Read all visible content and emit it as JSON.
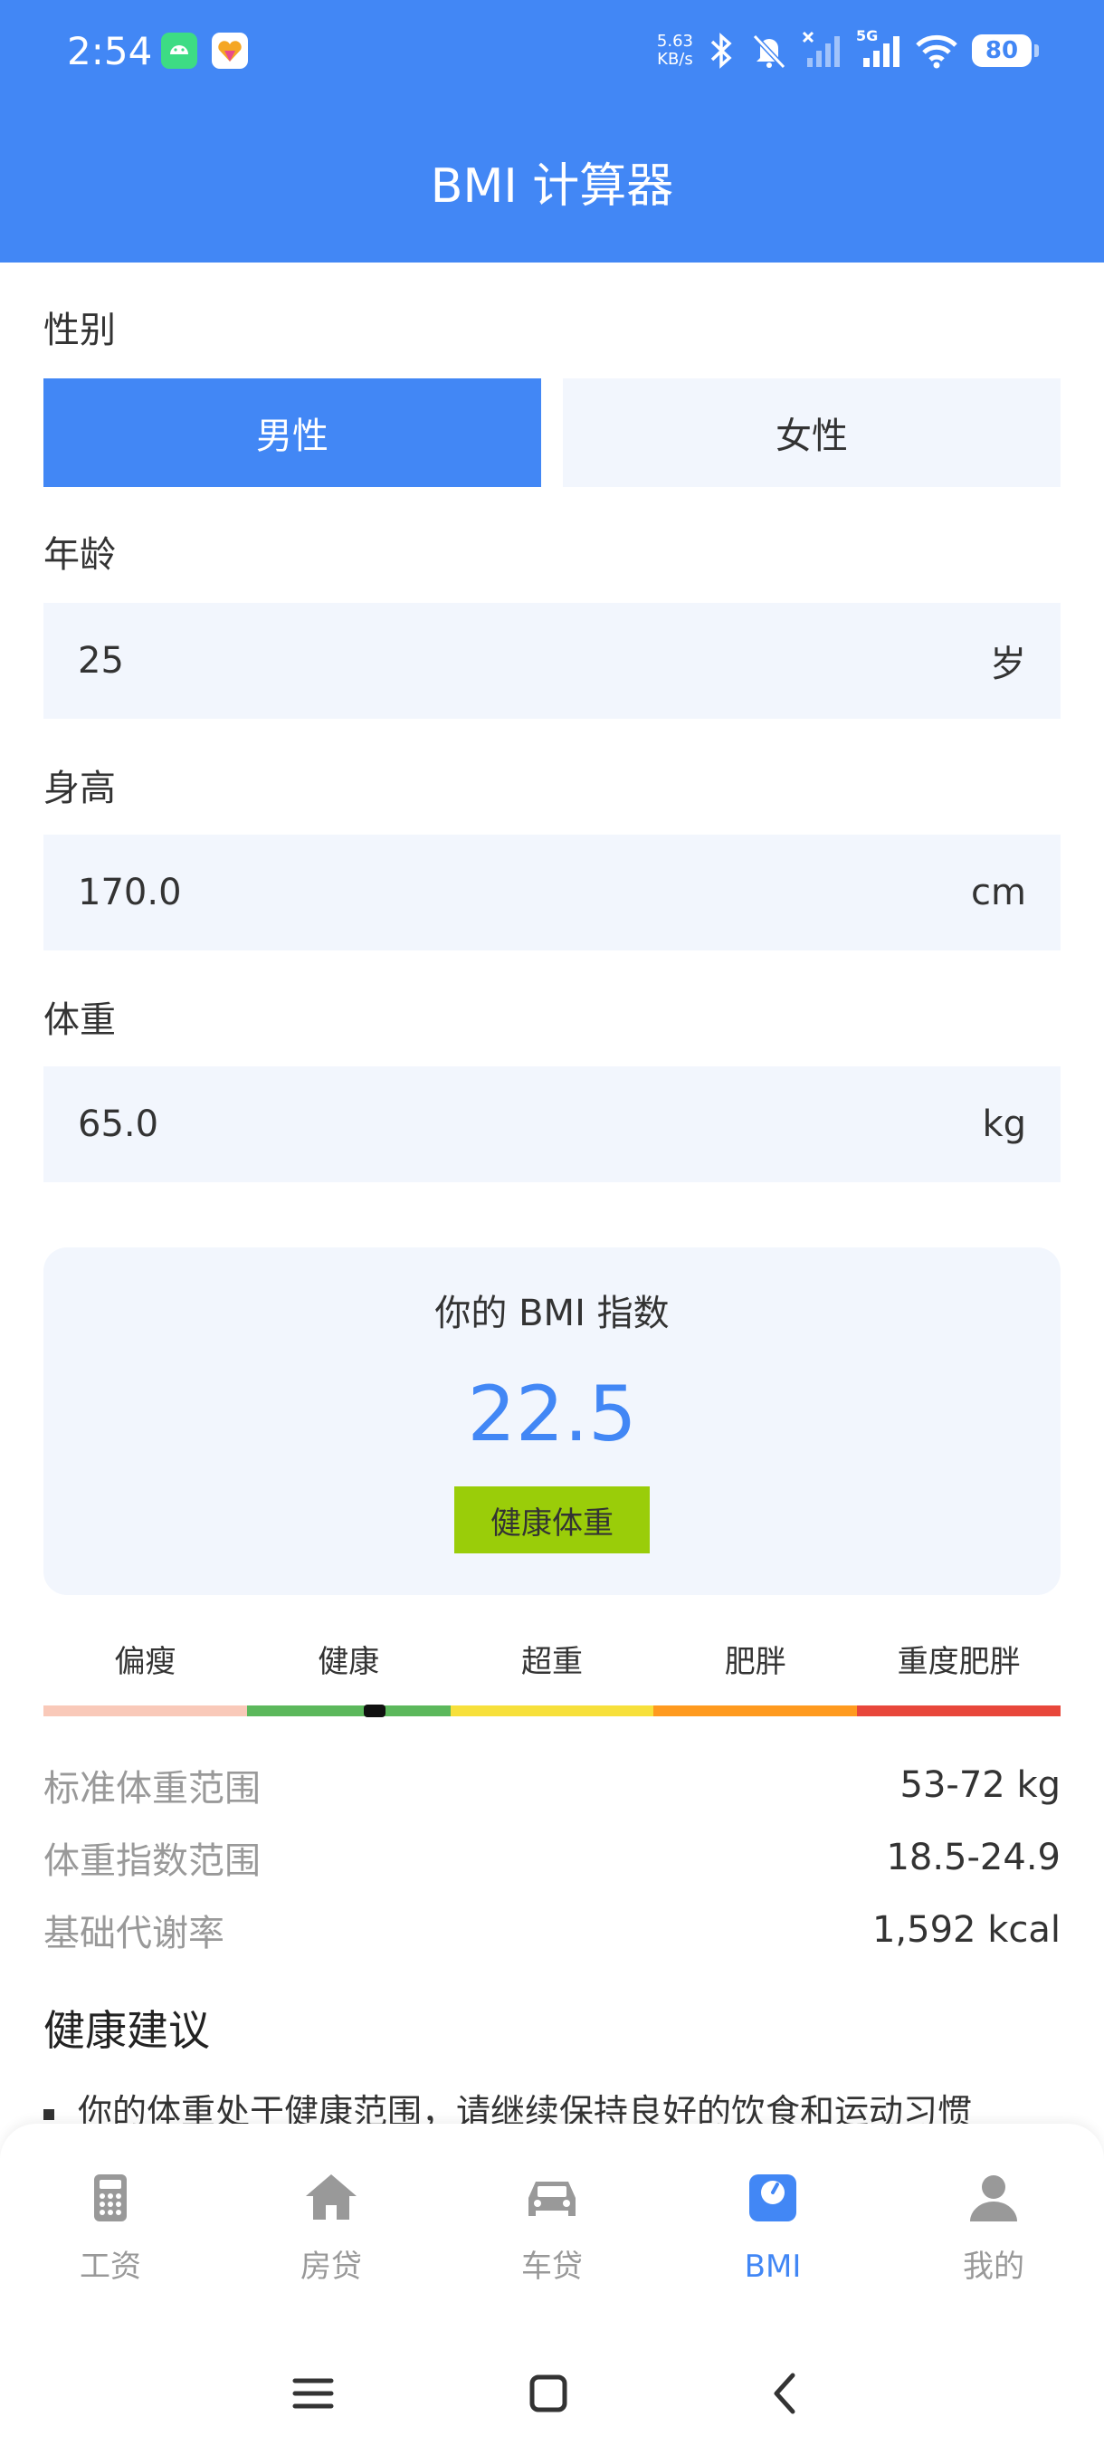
{
  "status_bar": {
    "time": "2:54",
    "net_speed_value": "5.63",
    "net_speed_unit": "KB/s",
    "signal_label": "5G",
    "battery": "80"
  },
  "header": {
    "title": "BMI 计算器"
  },
  "form": {
    "gender_label": "性别",
    "gender_options": [
      "男性",
      "女性"
    ],
    "gender_selected": "男性",
    "age_label": "年龄",
    "age_value": "25",
    "age_unit": "岁",
    "height_label": "身高",
    "height_value": "170.0",
    "height_unit": "cm",
    "weight_label": "体重",
    "weight_value": "65.0",
    "weight_unit": "kg"
  },
  "result": {
    "title": "你的 BMI 指数",
    "value": "22.5",
    "status": "健康体重",
    "status_color": "#9acd09"
  },
  "scale": {
    "categories": [
      "偏瘦",
      "健康",
      "超重",
      "肥胖",
      "重度肥胖"
    ],
    "colors": [
      "#f9c9b9",
      "#5cb85c",
      "#f7e03b",
      "#ff9a1f",
      "#e8473b"
    ],
    "marker_fraction": 0.326
  },
  "info": {
    "standard_weight_label": "标准体重范围",
    "standard_weight_value": "53-72 kg",
    "bmi_range_label": "体重指数范围",
    "bmi_range_value": "18.5-24.9",
    "bmr_label": "基础代谢率",
    "bmr_value": "1,592 kcal"
  },
  "advice": {
    "title": "健康建议",
    "items": [
      "你的体重处于健康范围，请继续保持良好的饮食和运动习惯"
    ]
  },
  "bottom_nav": {
    "items": [
      {
        "label": "工资",
        "icon": "calculator-icon"
      },
      {
        "label": "房贷",
        "icon": "house-icon"
      },
      {
        "label": "车贷",
        "icon": "car-icon"
      },
      {
        "label": "BMI",
        "icon": "scale-icon"
      },
      {
        "label": "我的",
        "icon": "person-icon"
      }
    ],
    "active": "BMI"
  },
  "system_nav": {
    "icons": [
      "menu-icon",
      "home-square-icon",
      "back-icon"
    ]
  },
  "colors": {
    "primary": "#4287f5",
    "input_bg": "#f2f6fd",
    "inactive": "#999999"
  }
}
